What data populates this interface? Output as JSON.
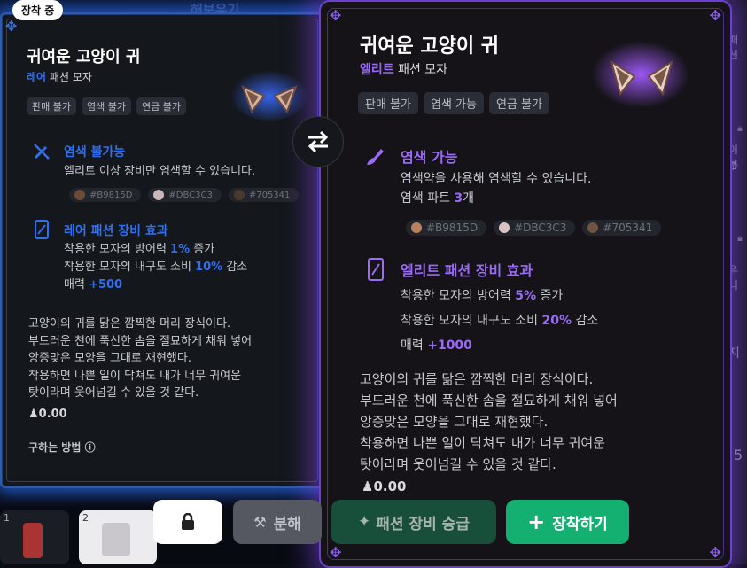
{
  "background": {
    "top_text": "해보유기"
  },
  "side_panel": {
    "labels": [
      "패션",
      "이름",
      "부",
      "유니",
      "지",
      "5"
    ]
  },
  "left_card": {
    "badge": "장착 중",
    "title": "귀여운 고양이 귀",
    "grade": "레어",
    "type": "패션 모자",
    "tags": [
      "판매 불가",
      "염색 불가",
      "연금 불가"
    ],
    "dye": {
      "title": "염색 불가능",
      "text": "엘리트 이상 장비만 염색할 수 있습니다."
    },
    "swatches": [
      {
        "color": "#B9815D",
        "label": "#B9815D"
      },
      {
        "color": "#DBC3C3",
        "label": "#DBC3C3"
      },
      {
        "color": "#705341",
        "label": "#705341"
      }
    ],
    "effect": {
      "title": "레어 패션 장비 효과",
      "line1_pre": "착용한 모자의 방어력 ",
      "line1_val": "1%",
      "line1_post": " 증가",
      "line2_pre": "착용한 모자의 내구도 소비 ",
      "line2_val": "10%",
      "line2_post": " 감소",
      "line3_pre": "매력 ",
      "line3_val": "+500"
    },
    "description": [
      "고양이의 귀를 닮은 깜찍한 머리 장식이다.",
      "부드러운 천에 푹신한 솜을 절묘하게 채워 넣어",
      "앙증맞은 모양을 그대로 재현했다.",
      "착용하면 나쁜 일이 닥쳐도 내가 너무 귀여운",
      "탓이라며 웃어넘길 수 있을 것 같다."
    ],
    "price": "0.00",
    "how_to": "구하는 방법"
  },
  "right_card": {
    "title": "귀여운 고양이 귀",
    "grade": "엘리트",
    "type": "패션 모자",
    "tags": [
      "판매 불가",
      "염색 가능",
      "연금 불가"
    ],
    "dye": {
      "title": "염색 가능",
      "text": "염색약을 사용해 염색할 수 있습니다.",
      "parts_pre": "염색 파트 ",
      "parts_val": "3",
      "parts_post": "개"
    },
    "swatches": [
      {
        "color": "#B9815D",
        "label": "#B9815D"
      },
      {
        "color": "#DBC3C3",
        "label": "#DBC3C3"
      },
      {
        "color": "#705341",
        "label": "#705341"
      }
    ],
    "effect": {
      "title": "엘리트 패션 장비 효과",
      "line1_pre": "착용한 모자의 방어력 ",
      "line1_val": "5%",
      "line1_post": " 증가",
      "line2_pre": "착용한 모자의 내구도 소비 ",
      "line2_val": "20%",
      "line2_post": " 감소",
      "line3_pre": "매력 ",
      "line3_val": "+1000"
    },
    "description": [
      "고양이의 귀를 닮은 깜찍한 머리 장식이다.",
      "부드러운 천에 푹신한 솜을 절묘하게 채워 넣어",
      "앙증맞은 모양을 그대로 재현했다.",
      "착용하면 나쁜 일이 닥쳐도 내가 너무 귀여운",
      "탓이라며 웃어넘길 수 있을 것 같다."
    ],
    "price": "0.00"
  },
  "actions": {
    "dismantle": "분해",
    "upgrade": "패션 장비 승급",
    "equip": "장착하기"
  },
  "slots": [
    "1",
    "2"
  ],
  "colors": {
    "rare_blue": "#2f6ff0",
    "elite_purple": "#9a6cf5",
    "equip_green": "#14b072"
  }
}
